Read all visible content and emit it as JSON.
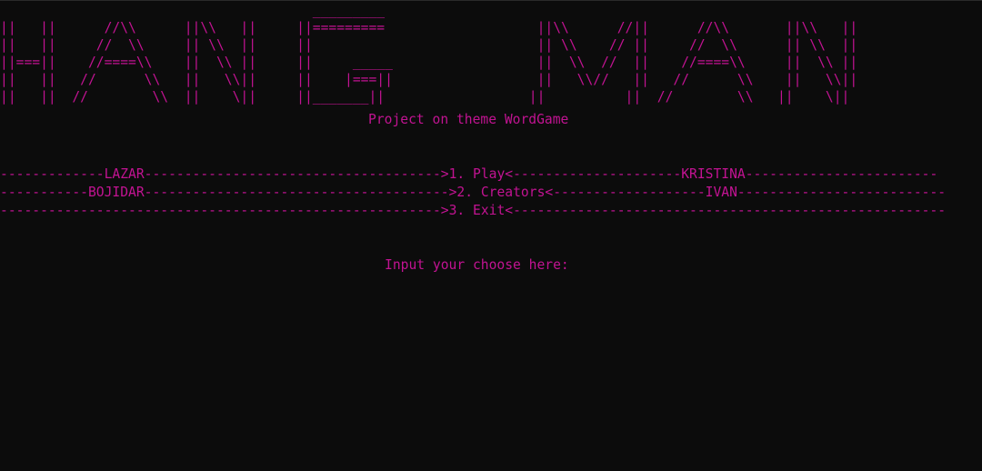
{
  "banner": {
    "art_lines": [
      "                                       _________",
      "||   ||      //\\\\      ||\\\\   ||     ||=========                   ||\\\\      //||      //\\\\       ||\\\\   ||",
      "||   ||     //  \\\\     || \\\\  ||     ||                            || \\\\    // ||     //  \\\\      || \\\\  ||",
      "||===||    //====\\\\    ||  \\\\ ||     ||     _____                  ||  \\\\  //  ||    //====\\\\     ||  \\\\ ||",
      "||   ||   //      \\\\   ||   \\\\||     ||    |===||                  ||   \\\\//   ||   //      \\\\    ||   \\\\||",
      "||   ||  //        \\\\  ||    \\||     ||_______||                  ||          ||  //        \\\\   ||    \\||"
    ]
  },
  "subtitle": "Project on theme WordGame",
  "menu": {
    "items": [
      "-------------LAZAR------------------------------------->1. Play<---------------------KRISTINA------------------------",
      "-----------BOJIDAR-------------------------------------->2. Creators<-------------------IVAN--------------------------",
      "------------------------------------------------------->3. Exit<------------------------------------------------------"
    ]
  },
  "prompt": {
    "text": "Input your choose here:"
  }
}
